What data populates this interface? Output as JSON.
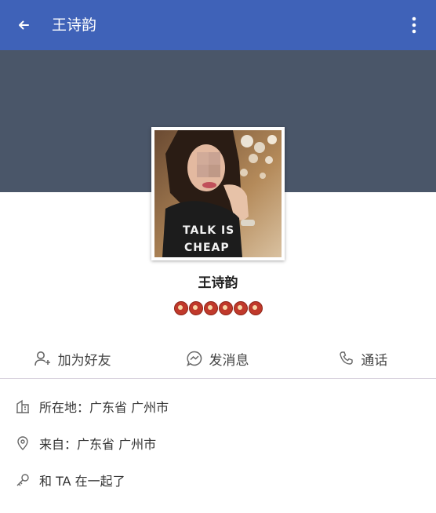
{
  "appbar": {
    "title": "王诗韵",
    "back_icon": "arrow-left-icon",
    "menu_icon": "more-vertical-icon",
    "color": "#3f62b8"
  },
  "cover": {
    "color": "#4a5669"
  },
  "profile": {
    "name": "王诗韵",
    "shirt_text_line1": "TALK IS",
    "shirt_text_line2": "CHEAP",
    "badge_count": 6
  },
  "actions": [
    {
      "label": "加为好友",
      "icon": "add-friend-icon"
    },
    {
      "label": "发消息",
      "icon": "message-icon"
    },
    {
      "label": "通话",
      "icon": "phone-icon"
    }
  ],
  "info": [
    {
      "text": "所在地：广东省 广州市",
      "icon": "building-icon"
    },
    {
      "text": "来自：广东省 广州市",
      "icon": "location-pin-icon"
    },
    {
      "text": "和 TA 在一起了",
      "icon": "key-icon"
    }
  ]
}
